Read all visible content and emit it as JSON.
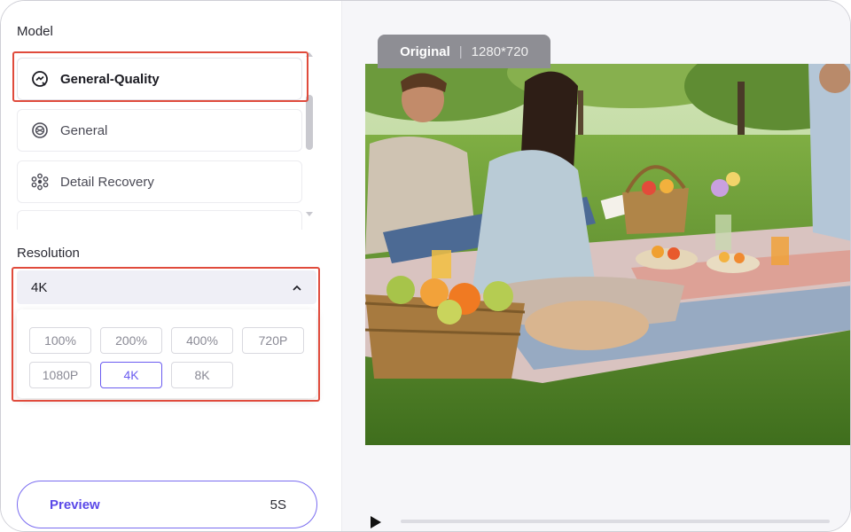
{
  "model": {
    "label": "Model",
    "items": [
      {
        "label": "General-Quality",
        "icon": "quality-sparkle-icon",
        "selected": true
      },
      {
        "label": "General",
        "icon": "layers-icon",
        "selected": false
      },
      {
        "label": "Detail Recovery",
        "icon": "dots-cluster-icon",
        "selected": false
      }
    ]
  },
  "resolution": {
    "label": "Resolution",
    "selected": "4K",
    "options": [
      "100%",
      "200%",
      "400%",
      "720P",
      "1080P",
      "4K",
      "8K"
    ]
  },
  "preview": {
    "label": "Preview",
    "cost": "5S"
  },
  "image": {
    "badge_label": "Original",
    "dimensions": "1280*720"
  },
  "colors": {
    "accent": "#6b5cf0",
    "highlight": "#e04b3c"
  }
}
